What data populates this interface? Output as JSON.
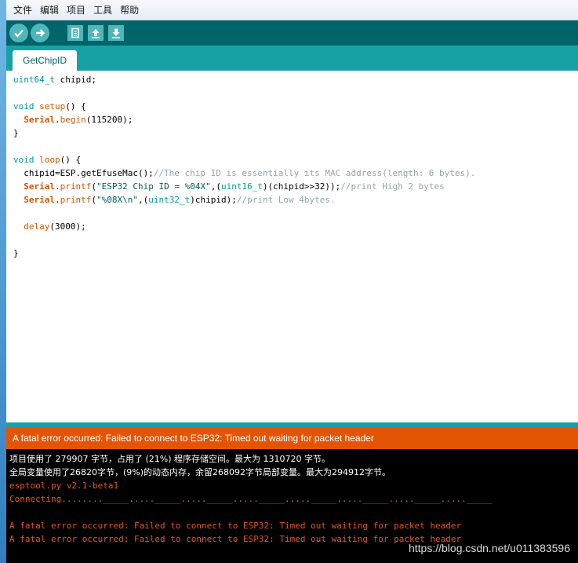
{
  "menubar": {
    "items": [
      "文件",
      "编辑",
      "项目",
      "工具",
      "帮助"
    ]
  },
  "toolbar": {
    "buttons": [
      "verify-icon",
      "upload-icon",
      "new-icon",
      "open-icon",
      "save-icon"
    ]
  },
  "tab": {
    "label": "GetChipID"
  },
  "code": {
    "l1": [
      "uint64_t",
      " chipid;"
    ],
    "l3": [
      "void",
      " ",
      "setup",
      "() {"
    ],
    "l4": [
      "  ",
      "Serial",
      ".",
      "begin",
      "(115200);"
    ],
    "l5": "}",
    "l7": [
      "void",
      " ",
      "loop",
      "() {"
    ],
    "l8": [
      "  chipid=ESP.getEfuseMac();",
      "//The chip ID is essentially its MAC address(length: 6 bytes)."
    ],
    "l9": [
      "  ",
      "Serial",
      ".",
      "printf",
      "(",
      "\"ESP32 Chip ID = %04X\"",
      ",(",
      "uint16_t",
      ")(chipid>>32));",
      "//print High 2 bytes"
    ],
    "l10": [
      "  ",
      "Serial",
      ".",
      "printf",
      "(",
      "\"%08X\\n\"",
      ",(",
      "uint32_t",
      ")chipid);",
      "//print Low 4bytes."
    ],
    "l12": [
      "  ",
      "delay",
      "(3000);"
    ],
    "l14": "}"
  },
  "status": {
    "message": "A fatal error occurred: Failed to connect to ESP32: Timed out waiting for packet header"
  },
  "console": {
    "line1": "项目使用了 279907 字节，占用了 (21%) 程序存储空间。最大为 1310720 字节。",
    "line2": "全局变量使用了26820字节，(9%)的动态内存，余留268092字节局部变量。最大为294912字节。",
    "line3": "esptool.py v2.1-beta1",
    "line4": "Connecting........_____....._____....._____....._____....._____....._____....._____....._____",
    "line6": "A fatal error occurred: Failed to connect to ESP32: Timed out waiting for packet header",
    "line7": "A fatal error occurred: Failed to connect to ESP32: Timed out waiting for packet header",
    "watermark": "https://blog.csdn.net/u011383596"
  },
  "colors": {
    "toolbar": "#006468",
    "tabbar": "#17a1a5",
    "status": "#e35505"
  }
}
